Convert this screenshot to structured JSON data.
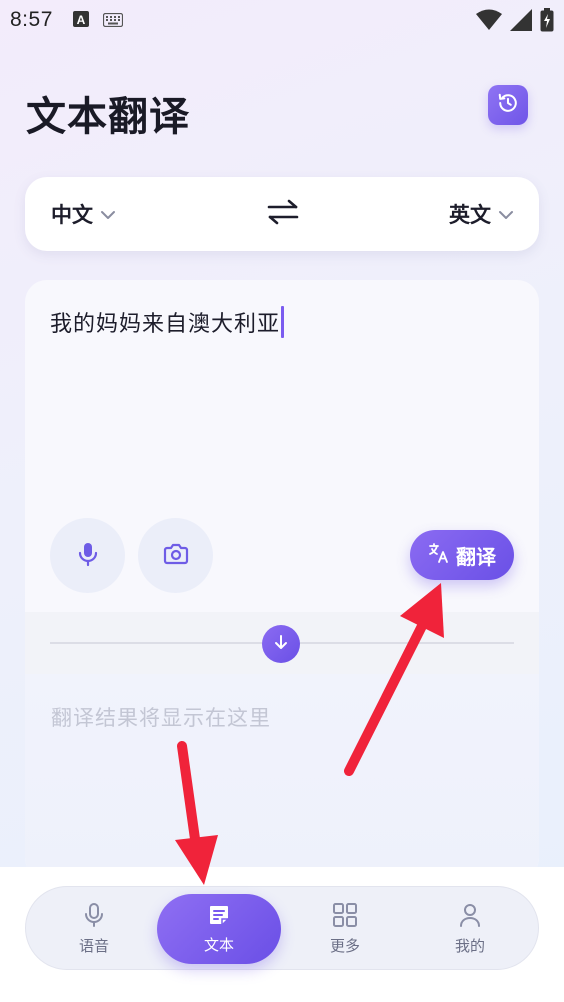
{
  "status_bar": {
    "time": "8:57",
    "icons_left": [
      "text-a-icon",
      "keyboard-icon"
    ],
    "icons_right": [
      "wifi-icon",
      "signal-icon",
      "battery-charging-icon"
    ]
  },
  "header": {
    "title": "文本翻译",
    "history_icon": "history-icon"
  },
  "language_bar": {
    "source_language": "中文",
    "target_language": "英文",
    "swap_icon": "swap-arrows-icon"
  },
  "input": {
    "text": "我的妈妈来自澳大利亚",
    "translate_label": "翻译"
  },
  "result": {
    "placeholder": "翻译结果将显示在这里"
  },
  "bottom_nav": {
    "items": [
      {
        "label": "语音",
        "icon": "microphone-icon",
        "active": false
      },
      {
        "label": "文本",
        "icon": "document-icon",
        "active": true
      },
      {
        "label": "更多",
        "icon": "grid-icon",
        "active": false
      },
      {
        "label": "我的",
        "icon": "person-icon",
        "active": false
      }
    ]
  },
  "colors": {
    "accent": "#7b5cf0",
    "annotation_arrow": "#f0233a"
  }
}
